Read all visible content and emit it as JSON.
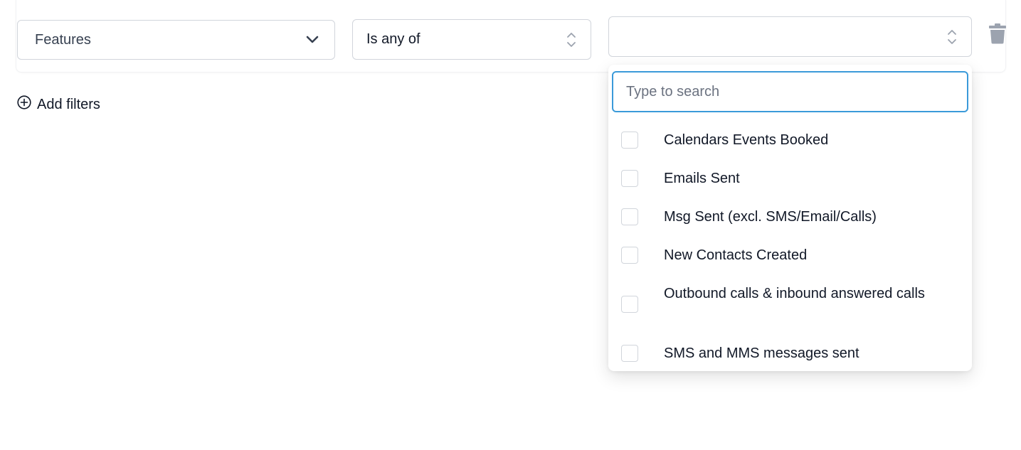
{
  "filter": {
    "field": {
      "value": "Features"
    },
    "operator": {
      "value": "Is any of"
    },
    "value_select": {
      "value": ""
    }
  },
  "add_filters_label": "Add filters",
  "dropdown": {
    "search_placeholder": "Type to search",
    "options": [
      {
        "label": "Calendars Events Booked",
        "checked": false
      },
      {
        "label": "Emails Sent",
        "checked": false
      },
      {
        "label": "Msg Sent (excl. SMS/Email/Calls)",
        "checked": false
      },
      {
        "label": "New Contacts Created",
        "checked": false
      },
      {
        "label": "Outbound calls & inbound answered calls",
        "checked": false
      },
      {
        "label": "SMS and MMS messages sent",
        "checked": false
      }
    ]
  },
  "colors": {
    "accent_focus": "#3b9ad9",
    "border": "#d1d5db",
    "icon_gray": "#9ca3af"
  },
  "icons": [
    "chevron-down-icon",
    "up-down-chevron-icon",
    "trash-icon",
    "plus-circle-icon"
  ]
}
